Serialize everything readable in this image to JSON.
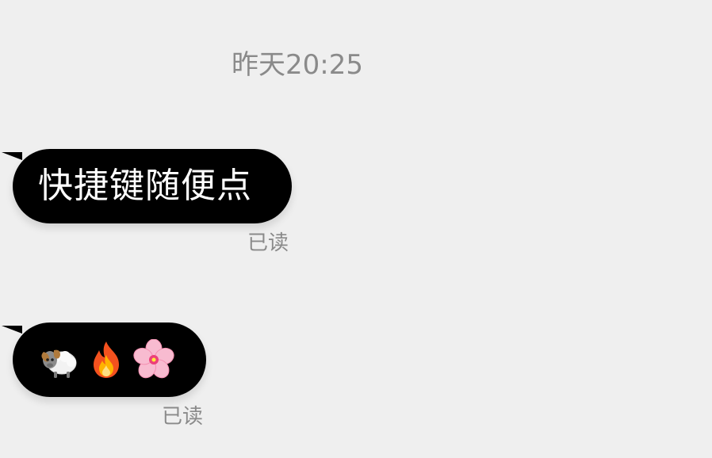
{
  "timestamp": "昨天20:25",
  "messages": [
    {
      "text": "快捷键随便点",
      "status": "已读"
    },
    {
      "emojis": [
        "ram-emoji",
        "fire-emoji",
        "cherry-blossom-emoji"
      ],
      "status": "已读"
    }
  ],
  "colors": {
    "background": "#efefef",
    "bubble": "#000000",
    "bubble_text": "#ffffff",
    "meta_text": "#8a8a8a"
  }
}
